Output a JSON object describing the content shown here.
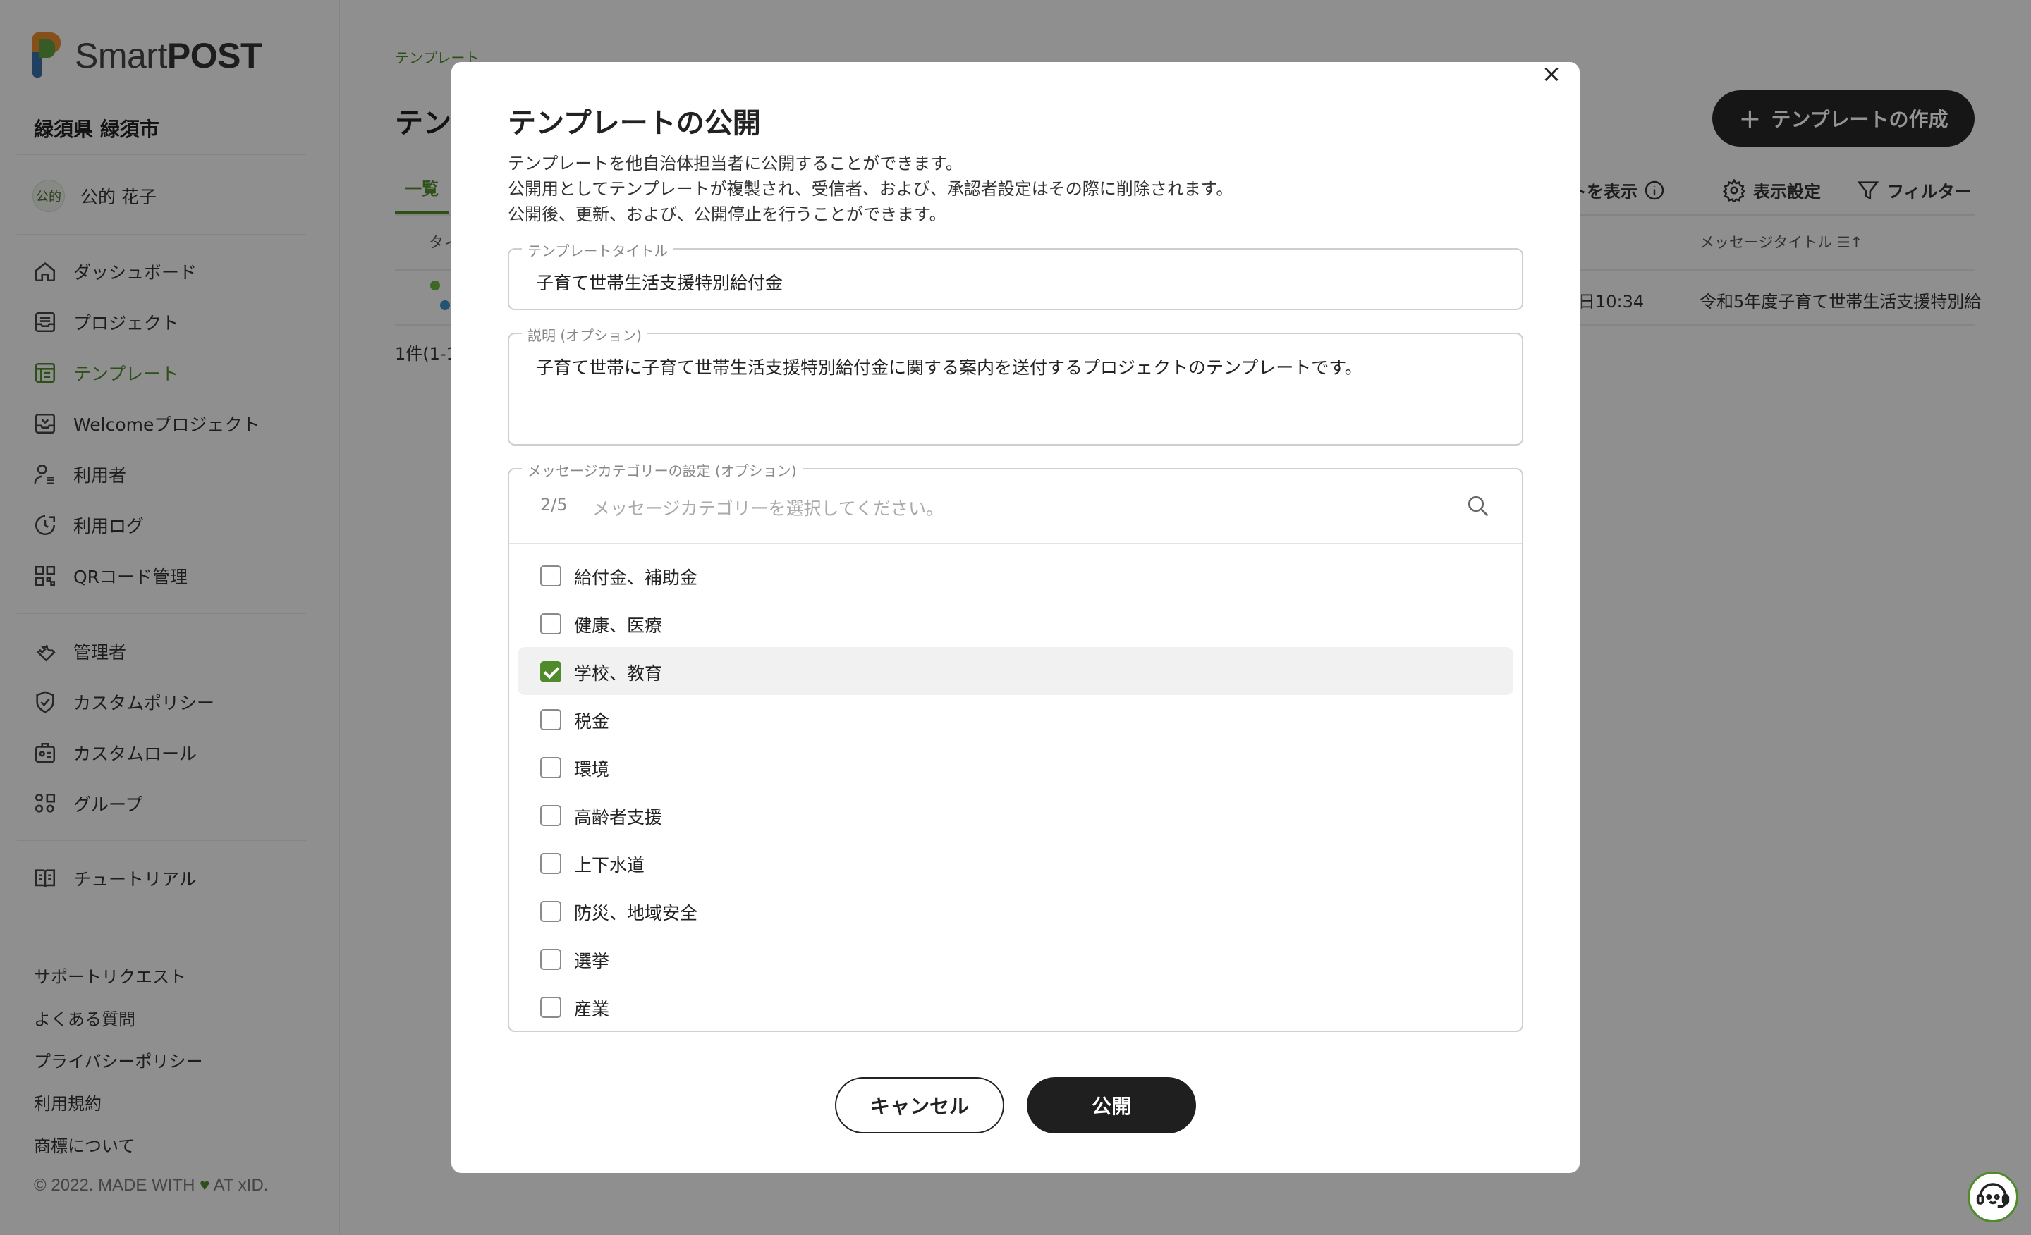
{
  "app": {
    "name_light": "Smart",
    "name_bold": "POST"
  },
  "org": "緑須県 緑須市",
  "user": {
    "badge": "公的",
    "name": "公的 花子"
  },
  "sidebar": {
    "nav": [
      {
        "label": "ダッシュボード",
        "icon": "home-icon"
      },
      {
        "label": "プロジェクト",
        "icon": "inbox-icon"
      },
      {
        "label": "テンプレート",
        "icon": "template-icon",
        "active": true
      },
      {
        "label": "Welcomeプロジェクト",
        "icon": "welcome-inbox-icon"
      },
      {
        "label": "利用者",
        "icon": "user-list-icon"
      },
      {
        "label": "利用ログ",
        "icon": "history-icon"
      },
      {
        "label": "QRコード管理",
        "icon": "qr-code-icon"
      }
    ],
    "admin": [
      {
        "label": "管理者",
        "icon": "wrench-icon"
      },
      {
        "label": "カスタムポリシー",
        "icon": "shield-check-icon"
      },
      {
        "label": "カスタムロール",
        "icon": "id-card-icon"
      },
      {
        "label": "グループ",
        "icon": "group-icon"
      }
    ],
    "tutorial": {
      "label": "チュートリアル",
      "icon": "book-icon"
    },
    "footer_links": [
      "サポートリクエスト",
      "よくある質問",
      "プライバシーポリシー",
      "利用規約",
      "商標について"
    ],
    "copyright_pre": "© 2022. MADE WITH",
    "copyright_post": "AT xID."
  },
  "main": {
    "breadcrumb": "テンプレート",
    "title": "テン",
    "create_button": "テンプレートの作成",
    "tab_list": "一覧",
    "toolbar": {
      "show_partial": "ートを表示",
      "display_settings": "表示設定",
      "filter": "フィルター"
    },
    "columns": {
      "first": "タィ",
      "message_title": "メッセージタイトル"
    },
    "row": {
      "time": "日10:34",
      "message_title": "令和5年度子育て世帯生活支援特別給"
    },
    "count": "1件(1-1"
  },
  "modal": {
    "title": "テンプレートの公開",
    "description": [
      "テンプレートを他自治体担当者に公開することができます。",
      "公開用としてテンプレートが複製され、受信者、および、承認者設定はその際に削除されます。",
      "公開後、更新、および、公開停止を行うことができます。"
    ],
    "template_title": {
      "label": "テンプレートタイトル",
      "value": "子育て世帯生活支援特別給付金"
    },
    "description_field": {
      "label": "説明 (オプション)",
      "value": "子育て世帯に子育て世帯生活支援特別給付金に関する案内を送付するプロジェクトのテンプレートです。"
    },
    "category": {
      "label": "メッセージカテゴリーの設定 (オプション)",
      "count": "2/5",
      "placeholder": "メッセージカテゴリーを選択してください。",
      "options": [
        {
          "label": "給付金、補助金",
          "checked": false
        },
        {
          "label": "健康、医療",
          "checked": false
        },
        {
          "label": "学校、教育",
          "checked": true
        },
        {
          "label": "税金",
          "checked": false
        },
        {
          "label": "環境",
          "checked": false
        },
        {
          "label": "高齢者支援",
          "checked": false
        },
        {
          "label": "上下水道",
          "checked": false
        },
        {
          "label": "防災、地域安全",
          "checked": false
        },
        {
          "label": "選挙",
          "checked": false
        },
        {
          "label": "産業",
          "checked": false
        }
      ]
    },
    "cancel": "キャンセル",
    "publish": "公開",
    "close": "×"
  },
  "colors": {
    "accent": "#4f8a2b",
    "dark": "#1f1f1f",
    "overlay": "rgba(0,0,0,0.42)"
  }
}
